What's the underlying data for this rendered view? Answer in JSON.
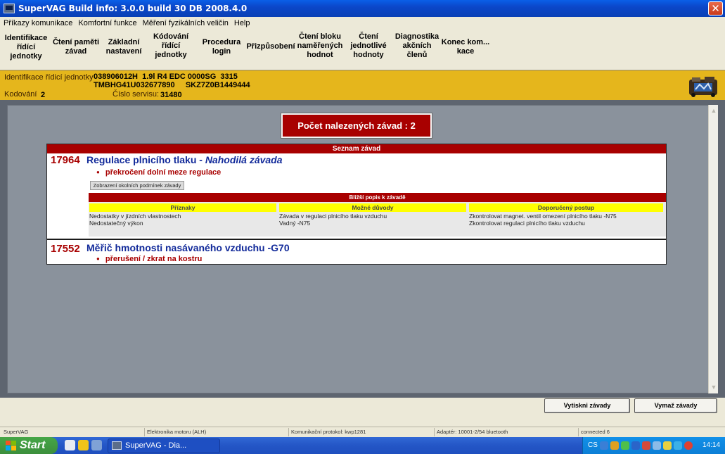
{
  "window": {
    "title": "SuperVAG Build info: 3.0.0 build 30 DB 2008.4.0",
    "close_glyph": "✕"
  },
  "menu": [
    "Příkazy komunikace",
    "Komfortní funkce",
    "Měření fyzikálních veličin",
    "Help"
  ],
  "toolbar": {
    "buttons": [
      "Identifikace\nřídící\njednotky",
      "Čtení paměti\nzávad",
      "Základní\nnastavení",
      "Kódování\nřídící\njednotky",
      "Procedura\nlogin",
      "Přizpůsobení",
      "Čtení bloku\nnaměřených\nhodnot",
      "Čtení\njednotlivé\nhodnoty",
      "Diagnostika\nakčních\nčlenů",
      "Konec kom...\nkace"
    ]
  },
  "info": {
    "ident_label": "Identifikace řídicí jednotky",
    "ident_line1": "038906012H  1.9l R4 EDC 0000SG  3315",
    "ident_line2": "TMBHG41U032677890     SKZ7Z0B1449444",
    "coding_label": "Kodování",
    "coding_value": "2",
    "service_label": "Číslo servisu:",
    "service_value": "31480"
  },
  "fault_count_text": "Počet nalezených závad : 2",
  "fault_list": {
    "header": "Seznam závad",
    "faults": [
      {
        "code": "17964",
        "name": "Regulace plnicího tlaku - ",
        "type": "Nahodilá závada",
        "detail": "překročení dolní meze regulace",
        "conditions_button": "Zobrazení okolních podmínek závady"
      },
      {
        "code": "17552",
        "name": "Měřič hmotnosti nasávaného vzduchu -G70",
        "detail": "přerušení / zkrat na kostru"
      }
    ]
  },
  "detail": {
    "header": "Bližší popis k závadě",
    "col_symptoms": "Příznaky",
    "col_causes": "Možné důvody",
    "col_fix": "Doporučený postup",
    "symptoms": [
      "Nedostatky v jízdních vlastnostech",
      "Nedostatečný výkon"
    ],
    "causes": [
      "Závada v regulaci plnicího tlaku vzduchu",
      "Vadný -N75"
    ],
    "fixes": [
      "Zkontrolovat magnet. ventil omezení plnicího tlaku -N75",
      "Zkontrolovat regulaci plnicího tlaku vzduchu"
    ]
  },
  "actions": {
    "print": "Vytiskni závady",
    "clear": "Vymaž závady"
  },
  "status": {
    "app": "SuperVAG",
    "module": "Elektronika motoru (ALH)",
    "protocol": "Komunikační protokol: kwp1281",
    "adapter": "Adaptér: 10001-2/54 bluetooth",
    "connection": "connected 6"
  },
  "taskbar": {
    "start": "Start",
    "task": "SuperVAG - Dia...",
    "lang": "CS",
    "clock": "14:14"
  },
  "colors": {
    "fault_red": "#A80000",
    "fault_blue": "#122a9a",
    "info_yellow": "#E5B61C",
    "column_yellow": "#FFFF00"
  }
}
